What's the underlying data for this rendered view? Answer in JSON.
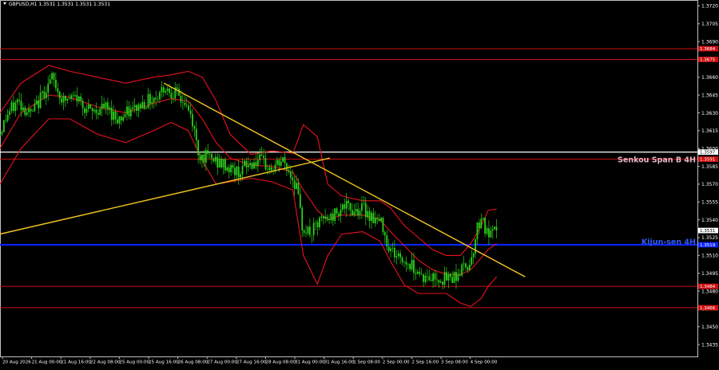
{
  "header": {
    "title": "GBPUSD,H1  1.3531 1.3531 1.3531 1.3531"
  },
  "colors": {
    "background": "#000000",
    "candle": "#2bd11b",
    "bollinger": "#e8121e",
    "trendline": "#f2c520",
    "level_red": "#cf1010",
    "senkou_line": "#ffffff",
    "kijun_line": "#0a23ff",
    "senkou_label": "#e8b4c8",
    "kijun_label": "#2f5bff"
  },
  "chart_data": {
    "type": "candlestick",
    "symbol": "GBPUSD",
    "timeframe": "H1",
    "ylim": [
      1.3425,
      1.3725
    ],
    "y_ticks": [
      "1.3720",
      "1.3705",
      "1.3690",
      "1.3675",
      "1.3660",
      "1.3645",
      "1.3630",
      "1.3615",
      "1.3600",
      "1.3585",
      "1.3570",
      "1.3555",
      "1.3540",
      "1.3525",
      "1.3510",
      "1.3495",
      "1.3480",
      "1.3465",
      "1.3450",
      "1.3435"
    ],
    "x_labels": [
      "20 Aug 2026",
      "21 Aug 00:00",
      "21 Aug 16:00",
      "22 Aug 08:00",
      "25 Aug 00:00",
      "25 Aug 16:00",
      "26 Aug 08:00",
      "27 Aug 00:00",
      "27 Aug 16:00",
      "28 Aug 08:00",
      "31 Aug 00:00",
      "31 Aug 16:00",
      "1 Sep 08:00",
      "2 Sep 00:00",
      "2 Sep 16:00",
      "3 Sep 08:00",
      "4 Sep 00:00"
    ],
    "last_price": "1.3531",
    "price_levels": [
      {
        "value": 1.3684,
        "label": "1.3684",
        "kind": "red"
      },
      {
        "value": 1.3675,
        "label": "1.3675",
        "kind": "red"
      },
      {
        "value": 1.3597,
        "label": "1.3597",
        "kind": "senkou"
      },
      {
        "value": 1.3591,
        "label": "1.3591",
        "kind": "red"
      },
      {
        "value": 1.3519,
        "label": "1.3519",
        "kind": "kijun"
      },
      {
        "value": 1.3484,
        "label": "1.3484",
        "kind": "red"
      },
      {
        "value": 1.3466,
        "label": "1.3466",
        "kind": "red"
      }
    ],
    "annotations": [
      {
        "text": "Senkou Span B 4H",
        "value": 1.3591,
        "kind": "senkou"
      },
      {
        "text": "Kijun-sen 4H",
        "value": 1.3522,
        "kind": "kijun"
      }
    ],
    "trendlines": [
      {
        "from": {
          "t": 0,
          "price": 1.3528
        },
        "to": {
          "t": 0.473,
          "price": 1.3592
        }
      },
      {
        "from": {
          "t": 0.235,
          "price": 1.3655
        },
        "to": {
          "t": 0.753,
          "price": 1.3492
        }
      }
    ],
    "close_anchors": [
      [
        0,
        1.3613
      ],
      [
        0.01,
        1.3628
      ],
      [
        0.025,
        1.364
      ],
      [
        0.045,
        1.3628
      ],
      [
        0.065,
        1.365
      ],
      [
        0.075,
        1.3659
      ],
      [
        0.09,
        1.364
      ],
      [
        0.11,
        1.3643
      ],
      [
        0.13,
        1.363
      ],
      [
        0.15,
        1.3635
      ],
      [
        0.17,
        1.3625
      ],
      [
        0.19,
        1.3632
      ],
      [
        0.21,
        1.364
      ],
      [
        0.225,
        1.3644
      ],
      [
        0.235,
        1.3652
      ],
      [
        0.25,
        1.3647
      ],
      [
        0.265,
        1.3638
      ],
      [
        0.275,
        1.3625
      ],
      [
        0.285,
        1.3595
      ],
      [
        0.3,
        1.3592
      ],
      [
        0.32,
        1.3586
      ],
      [
        0.34,
        1.358
      ],
      [
        0.355,
        1.3586
      ],
      [
        0.37,
        1.359
      ],
      [
        0.39,
        1.3582
      ],
      [
        0.405,
        1.359
      ],
      [
        0.415,
        1.358
      ],
      [
        0.425,
        1.3568
      ],
      [
        0.433,
        1.3535
      ],
      [
        0.445,
        1.3528
      ],
      [
        0.46,
        1.3539
      ],
      [
        0.475,
        1.3542
      ],
      [
        0.49,
        1.3552
      ],
      [
        0.505,
        1.3548
      ],
      [
        0.52,
        1.355
      ],
      [
        0.535,
        1.3542
      ],
      [
        0.55,
        1.3535
      ],
      [
        0.555,
        1.352
      ],
      [
        0.565,
        1.3512
      ],
      [
        0.58,
        1.3505
      ],
      [
        0.595,
        1.35
      ],
      [
        0.61,
        1.349
      ],
      [
        0.625,
        1.3492
      ],
      [
        0.64,
        1.349
      ],
      [
        0.655,
        1.3494
      ],
      [
        0.665,
        1.35
      ],
      [
        0.675,
        1.3505
      ],
      [
        0.684,
        1.3532
      ],
      [
        0.69,
        1.3545
      ],
      [
        0.697,
        1.3528
      ],
      [
        0.705,
        1.3526
      ],
      [
        0.712,
        1.3531
      ]
    ],
    "bollinger_upper": [
      [
        0,
        1.363
      ],
      [
        0.03,
        1.3655
      ],
      [
        0.07,
        1.367
      ],
      [
        0.1,
        1.3665
      ],
      [
        0.14,
        1.366
      ],
      [
        0.18,
        1.3655
      ],
      [
        0.22,
        1.366
      ],
      [
        0.245,
        1.3662
      ],
      [
        0.27,
        1.3665
      ],
      [
        0.29,
        1.366
      ],
      [
        0.31,
        1.364
      ],
      [
        0.33,
        1.3612
      ],
      [
        0.36,
        1.3595
      ],
      [
        0.39,
        1.3598
      ],
      [
        0.42,
        1.3596
      ],
      [
        0.435,
        1.362
      ],
      [
        0.455,
        1.361
      ],
      [
        0.47,
        1.357
      ],
      [
        0.49,
        1.356
      ],
      [
        0.52,
        1.3556
      ],
      [
        0.545,
        1.3556
      ],
      [
        0.56,
        1.355
      ],
      [
        0.58,
        1.3535
      ],
      [
        0.6,
        1.3525
      ],
      [
        0.62,
        1.3515
      ],
      [
        0.64,
        1.351
      ],
      [
        0.66,
        1.351
      ],
      [
        0.675,
        1.352
      ],
      [
        0.69,
        1.3535
      ],
      [
        0.7,
        1.3548
      ],
      [
        0.712,
        1.3549
      ]
    ],
    "bollinger_middle": [
      [
        0,
        1.36
      ],
      [
        0.03,
        1.363
      ],
      [
        0.07,
        1.3645
      ],
      [
        0.1,
        1.3643
      ],
      [
        0.14,
        1.3635
      ],
      [
        0.18,
        1.363
      ],
      [
        0.22,
        1.3638
      ],
      [
        0.245,
        1.3642
      ],
      [
        0.27,
        1.364
      ],
      [
        0.29,
        1.3625
      ],
      [
        0.31,
        1.3605
      ],
      [
        0.33,
        1.3592
      ],
      [
        0.36,
        1.3586
      ],
      [
        0.39,
        1.3585
      ],
      [
        0.42,
        1.358
      ],
      [
        0.435,
        1.3565
      ],
      [
        0.455,
        1.3548
      ],
      [
        0.47,
        1.354
      ],
      [
        0.49,
        1.3544
      ],
      [
        0.52,
        1.3544
      ],
      [
        0.545,
        1.354
      ],
      [
        0.56,
        1.353
      ],
      [
        0.58,
        1.3518
      ],
      [
        0.6,
        1.3506
      ],
      [
        0.62,
        1.3498
      ],
      [
        0.64,
        1.3494
      ],
      [
        0.66,
        1.3494
      ],
      [
        0.675,
        1.3498
      ],
      [
        0.69,
        1.3508
      ],
      [
        0.7,
        1.3515
      ],
      [
        0.712,
        1.352
      ]
    ],
    "bollinger_lower": [
      [
        0,
        1.357
      ],
      [
        0.03,
        1.36
      ],
      [
        0.07,
        1.3625
      ],
      [
        0.1,
        1.3625
      ],
      [
        0.14,
        1.3612
      ],
      [
        0.18,
        1.3605
      ],
      [
        0.22,
        1.3615
      ],
      [
        0.245,
        1.3622
      ],
      [
        0.27,
        1.3615
      ],
      [
        0.29,
        1.359
      ],
      [
        0.31,
        1.357
      ],
      [
        0.33,
        1.3572
      ],
      [
        0.36,
        1.3575
      ],
      [
        0.39,
        1.3572
      ],
      [
        0.42,
        1.3565
      ],
      [
        0.435,
        1.351
      ],
      [
        0.455,
        1.3486
      ],
      [
        0.47,
        1.351
      ],
      [
        0.49,
        1.3528
      ],
      [
        0.52,
        1.353
      ],
      [
        0.545,
        1.3522
      ],
      [
        0.56,
        1.3505
      ],
      [
        0.58,
        1.3485
      ],
      [
        0.6,
        1.3478
      ],
      [
        0.62,
        1.3478
      ],
      [
        0.64,
        1.3478
      ],
      [
        0.66,
        1.347
      ],
      [
        0.675,
        1.3467
      ],
      [
        0.69,
        1.3474
      ],
      [
        0.7,
        1.3484
      ],
      [
        0.712,
        1.3492
      ]
    ]
  }
}
